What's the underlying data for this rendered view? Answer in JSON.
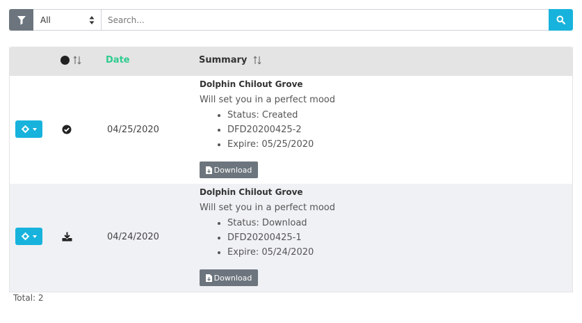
{
  "toolbar": {
    "filter_select_value": "All",
    "search_placeholder": "Search..."
  },
  "table": {
    "headers": {
      "date": "Date",
      "summary": "Summary"
    },
    "rows": [
      {
        "status_icon": "check-circle-icon",
        "date": "04/25/2020",
        "title": "Dolphin Chilout Grove",
        "description": "Will set you in a perfect mood",
        "details": [
          "Status: Created",
          "DFD20200425-2",
          "Expire: 05/25/2020"
        ],
        "download_label": "Download"
      },
      {
        "status_icon": "download-tray-icon",
        "date": "04/24/2020",
        "title": "Dolphin Chilout Grove",
        "description": "Will set you in a perfect mood",
        "details": [
          "Status: Download",
          "DFD20200425-1",
          "Expire: 05/24/2020"
        ],
        "download_label": "Download"
      }
    ]
  },
  "footer": {
    "total": "Total: 2"
  },
  "colors": {
    "accent": "#17b3dc",
    "date_header": "#2ecc8f",
    "button_gray": "#6c757d",
    "header_bg": "#e4e4e4",
    "alt_row_bg": "#f0f1f5"
  }
}
